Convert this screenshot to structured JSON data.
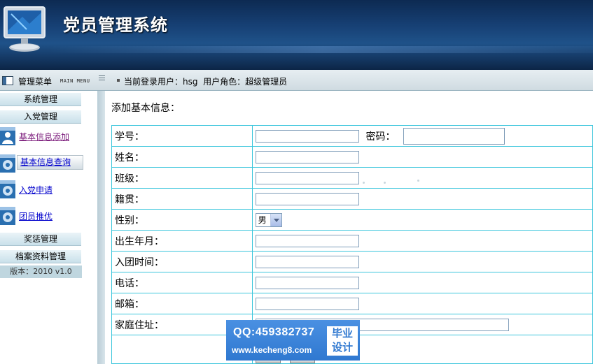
{
  "app": {
    "title": "党员管理系统"
  },
  "statusbar": {
    "menu_title": "管理菜单",
    "menu_sub": "MAIN MENU",
    "user_info": "当前登录用户：hsg  用户角色：超级管理员"
  },
  "sidebar": {
    "categories": [
      {
        "label": "系统管理"
      },
      {
        "label": "入党管理"
      },
      {
        "label": "奖惩管理"
      },
      {
        "label": "档案资料管理"
      }
    ],
    "items": [
      {
        "label": "基本信息添加",
        "icon": "person-icon"
      },
      {
        "label": "基本信息查询",
        "icon": "gear-icon"
      },
      {
        "label": "入党申请",
        "icon": "gear-icon"
      },
      {
        "label": "团员推优",
        "icon": "gear-icon"
      }
    ],
    "version": "版本：2010 v1.0"
  },
  "form": {
    "heading": "添加基本信息：",
    "fields": {
      "student_id": {
        "label": "学号：",
        "value": ""
      },
      "password": {
        "label": "密码：",
        "value": ""
      },
      "name": {
        "label": "姓名：",
        "value": ""
      },
      "class": {
        "label": "班级：",
        "value": ""
      },
      "origin": {
        "label": "籍贯：",
        "value": ""
      },
      "gender": {
        "label": "性别：",
        "value": "男"
      },
      "birth": {
        "label": "出生年月：",
        "value": ""
      },
      "league_date": {
        "label": "入团时间：",
        "value": ""
      },
      "phone": {
        "label": "电话：",
        "value": ""
      },
      "email": {
        "label": "邮箱：",
        "value": ""
      },
      "address": {
        "label": "家庭住址：",
        "value": ""
      }
    }
  },
  "watermark": {
    "qq": "QQ:459382737",
    "url": "www.kecheng8.com",
    "badge_line1": "毕业",
    "badge_line2": "设计"
  },
  "colors": {
    "header_bg": "#163f73",
    "table_border": "#3cc6dc",
    "link": "#0000cc",
    "link_visited": "#7b1b7b",
    "watermark_bg": "#2f78d0"
  }
}
